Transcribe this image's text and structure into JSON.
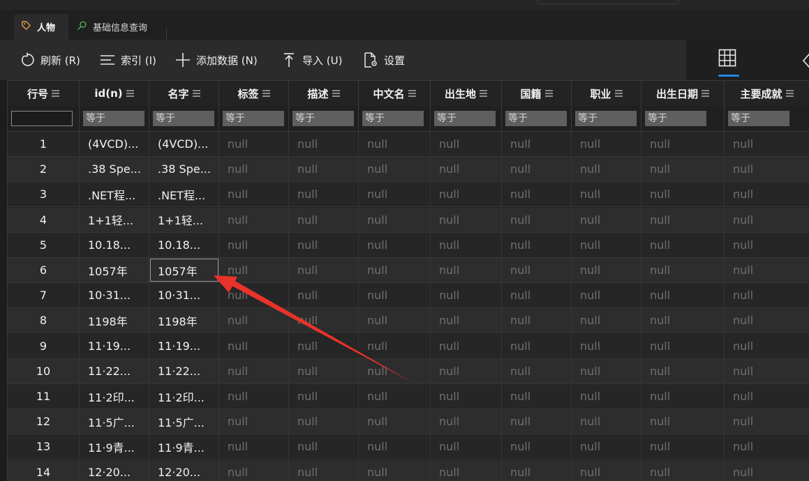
{
  "tabs": [
    {
      "label": "人物",
      "icon": "tag-icon",
      "active": true
    },
    {
      "label": "基础信息查询",
      "icon": "search-icon",
      "active": false
    }
  ],
  "toolbar": {
    "refresh": "刷新 (R)",
    "index": "索引 (I)",
    "add": "添加数据 (N)",
    "import": "导入 (U)",
    "settings": "设置"
  },
  "columns": [
    "行号",
    "id(n)",
    "名字",
    "标签",
    "描述",
    "中文名",
    "出生地",
    "国籍",
    "职业",
    "出生日期",
    "主要成就"
  ],
  "filter_placeholder": "等于",
  "null_text": "null",
  "rows": [
    [
      "1",
      "(4VCD)...",
      "(4VCD)..."
    ],
    [
      "2",
      ".38 Spe...",
      ".38 Spe..."
    ],
    [
      "3",
      ".NET程...",
      ".NET程..."
    ],
    [
      "4",
      "1+1轻...",
      "1+1轻..."
    ],
    [
      "5",
      "10.18...",
      "10.18..."
    ],
    [
      "6",
      "1057年",
      "1057年"
    ],
    [
      "7",
      "10·31...",
      "10·31..."
    ],
    [
      "8",
      "1198年",
      "1198年"
    ],
    [
      "9",
      "11·19...",
      "11·19..."
    ],
    [
      "10",
      "11·22...",
      "11·22..."
    ],
    [
      "11",
      "11·2印...",
      "11·2印..."
    ],
    [
      "12",
      "11·5广...",
      "11·5广..."
    ],
    [
      "13",
      "11·9青...",
      "11·9青..."
    ],
    [
      "14",
      "12·20...",
      "12·20..."
    ]
  ],
  "selected_cell": {
    "row": 6,
    "column": "名字"
  },
  "colors": {
    "accent": "#1e88e5",
    "arrow": "#e8332a"
  }
}
